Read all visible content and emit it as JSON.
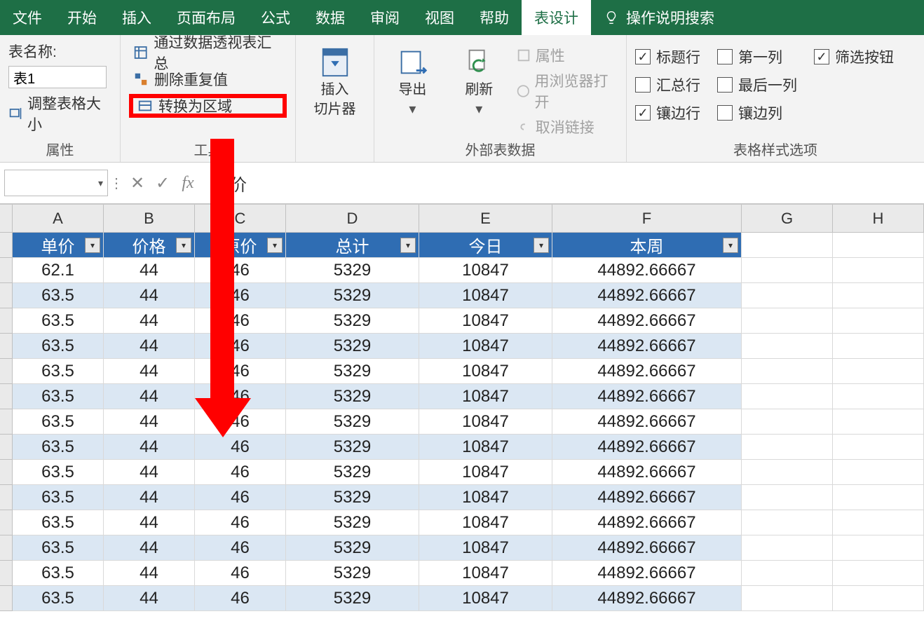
{
  "ribbon": {
    "tabs": {
      "file": "文件",
      "home": "开始",
      "insert": "插入",
      "layout": "页面布局",
      "formula": "公式",
      "data": "数据",
      "review": "审阅",
      "view": "视图",
      "help": "帮助",
      "table_design": "表设计"
    },
    "help_search": "操作说明搜索",
    "g1": {
      "table_name_label": "表名称:",
      "table_name_value": "表1",
      "resize": "调整表格大小",
      "group_label": "属性"
    },
    "g2": {
      "pivot": "通过数据透视表汇总",
      "dedup": "删除重复值",
      "convert": "转换为区域",
      "group_label": "工具"
    },
    "slicer": {
      "line1": "插入",
      "line2": "切片器"
    },
    "export": "导出",
    "refresh": "刷新",
    "ext": {
      "properties": "属性",
      "browser_open": "用浏览器打开",
      "unlink": "取消链接",
      "group_label": "外部表数据"
    },
    "opts": {
      "header_row": "标题行",
      "total_row": "汇总行",
      "banded_row": "镶边行",
      "first_col": "第一列",
      "last_col": "最后一列",
      "banded_col": "镶边列",
      "filter_btn": "筛选按钮",
      "group_label": "表格样式选项"
    }
  },
  "formula_bar": {
    "value": "单价"
  },
  "columns": [
    "A",
    "B",
    "C",
    "D",
    "E",
    "F",
    "G",
    "H"
  ],
  "table": {
    "headers": [
      "单价",
      "价格",
      "原价",
      "总计",
      "今日",
      "本周"
    ],
    "rows": [
      [
        "62.1",
        "44",
        "46",
        "5329",
        "10847",
        "44892.66667"
      ],
      [
        "63.5",
        "44",
        "46",
        "5329",
        "10847",
        "44892.66667"
      ],
      [
        "63.5",
        "44",
        "46",
        "5329",
        "10847",
        "44892.66667"
      ],
      [
        "63.5",
        "44",
        "46",
        "5329",
        "10847",
        "44892.66667"
      ],
      [
        "63.5",
        "44",
        "46",
        "5329",
        "10847",
        "44892.66667"
      ],
      [
        "63.5",
        "44",
        "46",
        "5329",
        "10847",
        "44892.66667"
      ],
      [
        "63.5",
        "44",
        "46",
        "5329",
        "10847",
        "44892.66667"
      ],
      [
        "63.5",
        "44",
        "46",
        "5329",
        "10847",
        "44892.66667"
      ],
      [
        "63.5",
        "44",
        "46",
        "5329",
        "10847",
        "44892.66667"
      ],
      [
        "63.5",
        "44",
        "46",
        "5329",
        "10847",
        "44892.66667"
      ],
      [
        "63.5",
        "44",
        "46",
        "5329",
        "10847",
        "44892.66667"
      ],
      [
        "63.5",
        "44",
        "46",
        "5329",
        "10847",
        "44892.66667"
      ],
      [
        "63.5",
        "44",
        "46",
        "5329",
        "10847",
        "44892.66667"
      ],
      [
        "63.5",
        "44",
        "46",
        "5329",
        "10847",
        "44892.66667"
      ]
    ]
  }
}
